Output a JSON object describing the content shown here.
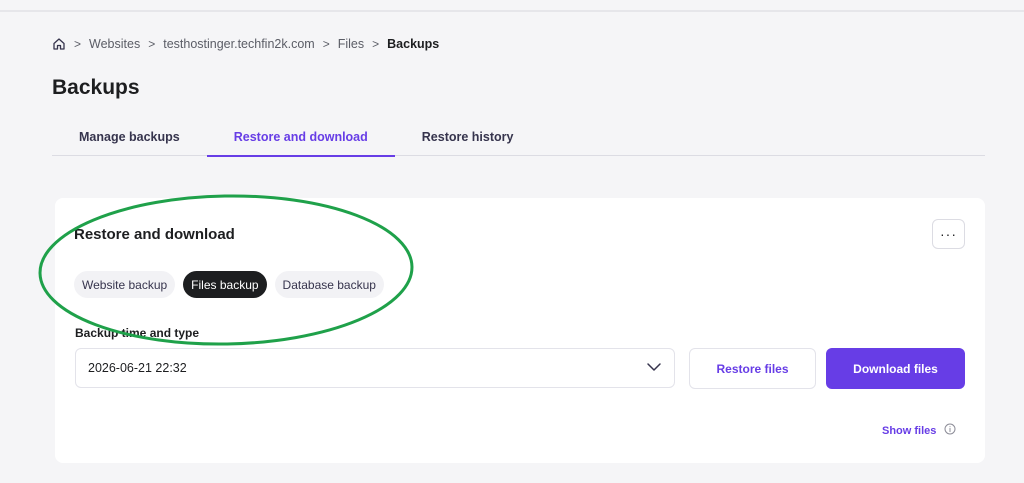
{
  "breadcrumb": {
    "items": [
      "Websites",
      "testhostinger.techfin2k.com",
      "Files"
    ],
    "current": "Backups"
  },
  "page": {
    "title": "Backups"
  },
  "tabs": [
    {
      "label": "Manage backups"
    },
    {
      "label": "Restore and download"
    },
    {
      "label": "Restore history"
    }
  ],
  "card": {
    "title": "Restore and download",
    "chips": [
      {
        "label": "Website backup"
      },
      {
        "label": "Files backup"
      },
      {
        "label": "Database backup"
      }
    ],
    "field_label": "Backup time and type",
    "select_value": "2026-06-21 22:32",
    "restore_label": "Restore files",
    "download_label": "Download files",
    "show_files_label": "Show files"
  },
  "icons": {
    "home": "home-icon",
    "more": "more-horizontal-icon",
    "chevron": "chevron-down-icon",
    "info": "info-icon"
  },
  "colors": {
    "accent": "#673de6",
    "annotation": "#1fa14a",
    "active_chip": "#1d1e20"
  }
}
